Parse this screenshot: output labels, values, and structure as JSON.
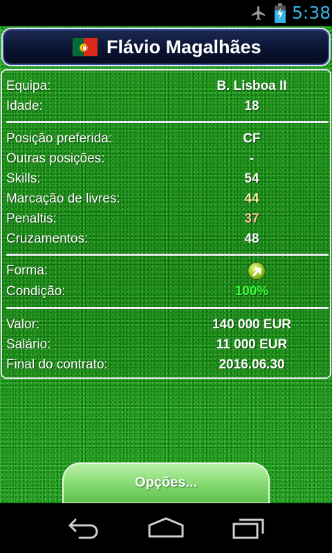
{
  "status_bar": {
    "time": "5:38",
    "icons": [
      "airplane-mode-icon",
      "battery-charging-icon"
    ]
  },
  "header": {
    "flag": "portugal-flag-icon",
    "player_name": "Flávio Magalhães"
  },
  "info": {
    "team": {
      "label": "Equipa:",
      "value": "B. Lisboa II"
    },
    "age": {
      "label": "Idade:",
      "value": "18"
    },
    "preferred_position": {
      "label": "Posição preferida:",
      "value": "CF"
    },
    "other_positions": {
      "label": "Outras posições:",
      "value": "-"
    },
    "skills": {
      "label": "Skills:",
      "value": "54"
    },
    "free_kicks": {
      "label": "Marcação de livres:",
      "value": "44"
    },
    "penalties": {
      "label": "Penaltis:",
      "value": "37"
    },
    "crosses": {
      "label": "Cruzamentos:",
      "value": "48"
    },
    "form": {
      "label": "Forma:",
      "icon": "form-up-arrow-icon"
    },
    "condition": {
      "label": "Condição:",
      "value": "100%"
    },
    "value": {
      "label": "Valor:",
      "value": "140 000 EUR"
    },
    "salary": {
      "label": "Salário:",
      "value": "11 000 EUR"
    },
    "contract_end": {
      "label": "Final do contrato:",
      "value": "2016.06.30"
    }
  },
  "colors": {
    "free_kicks_value": "#f6f1a8",
    "penalties_value": "#f8c6a0",
    "condition_value": "#37ff37",
    "header_bg": "#0a1433",
    "accent": "#33b5e5"
  },
  "options_button": {
    "label": "Opções..."
  },
  "nav_bar": {
    "back": "back-icon",
    "home": "home-icon",
    "recents": "recent-apps-icon"
  }
}
